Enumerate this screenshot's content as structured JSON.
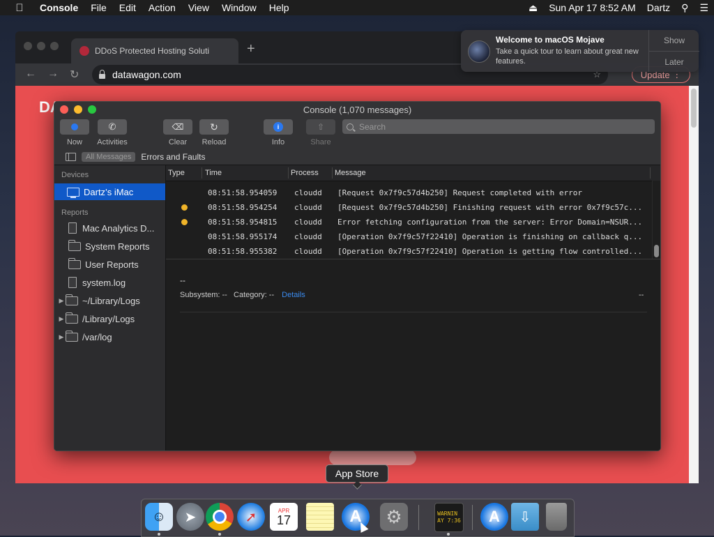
{
  "menubar": {
    "app_name": "Console",
    "items": [
      "File",
      "Edit",
      "Action",
      "View",
      "Window",
      "Help"
    ],
    "datetime": "Sun Apr 17  8:52 AM",
    "user": "Dartz"
  },
  "browser": {
    "tab_title": "DDoS Protected Hosting Soluti",
    "url": "datawagon.com",
    "update_label": "Update",
    "page_logo": "DA"
  },
  "notification": {
    "title": "Welcome to macOS Mojave",
    "body": "Take a quick tour to learn about great new features.",
    "show_label": "Show",
    "later_label": "Later"
  },
  "console": {
    "window_title": "Console (1,070 messages)",
    "toolbar": {
      "now": "Now",
      "activities": "Activities",
      "clear": "Clear",
      "reload": "Reload",
      "info": "Info",
      "share": "Share"
    },
    "search_placeholder": "Search",
    "filter": {
      "all_messages": "All Messages",
      "errors_faults": "Errors and Faults"
    },
    "sidebar": {
      "devices_header": "Devices",
      "device": "Dartz’s iMac",
      "reports_header": "Reports",
      "reports": [
        "Mac Analytics D...",
        "System Reports",
        "User Reports",
        "system.log",
        "~/Library/Logs",
        "/Library/Logs",
        "/var/log"
      ]
    },
    "columns": [
      "Type",
      "Time",
      "Process",
      "Message"
    ],
    "rows": [
      {
        "time": "08:51:58.954059",
        "process": "cloudd",
        "message": "[Request 0x7f9c57d4b250] Request completed with error"
      },
      {
        "time": "08:51:58.954254",
        "process": "cloudd",
        "message": "[Request 0x7f9c57d4b250] Finishing request with error 0x7f9c57c..."
      },
      {
        "time": "08:51:58.954815",
        "process": "cloudd",
        "message": "Error fetching configuration from the server: Error Domain=NSUR..."
      },
      {
        "time": "08:51:58.955174",
        "process": "cloudd",
        "message": "[Operation 0x7f9c57f22410] Operation is finishing on callback q..."
      },
      {
        "time": "08:51:58.955382",
        "process": "cloudd",
        "message": "[Operation 0x7f9c57f22410] Operation is getting flow controlled..."
      }
    ],
    "detail": {
      "title": "--",
      "subsystem": "Subsystem: --",
      "category": "Category: --",
      "details_link": "Details",
      "right": "--"
    }
  },
  "dock": {
    "tooltip": "App Store",
    "calendar_month": "APR",
    "calendar_day": "17",
    "console_icon_text": "WARNIN\nAY 7:36"
  }
}
